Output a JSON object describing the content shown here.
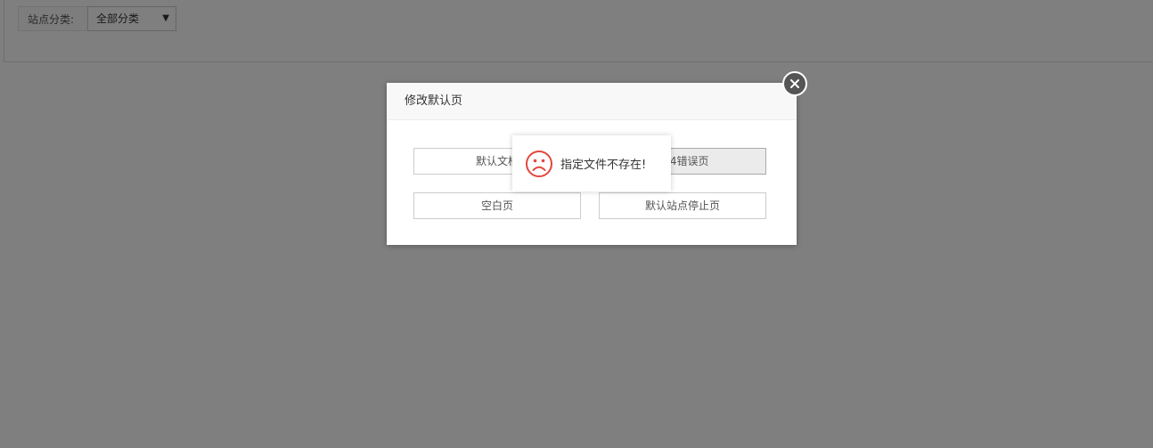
{
  "filter": {
    "label": "站点分类:",
    "select_value": "全部分类"
  },
  "dialog": {
    "title": "修改默认页",
    "buttons": [
      {
        "label": "默认文档"
      },
      {
        "label": "404错误页"
      },
      {
        "label": "空白页"
      },
      {
        "label": "默认站点停止页"
      }
    ]
  },
  "toast": {
    "message": "指定文件不存在!",
    "icon": "sad-face-icon",
    "icon_color": "#e0483c"
  },
  "colors": {
    "overlay": "rgba(0,0,0,0.5)",
    "close_button": "#555555"
  }
}
